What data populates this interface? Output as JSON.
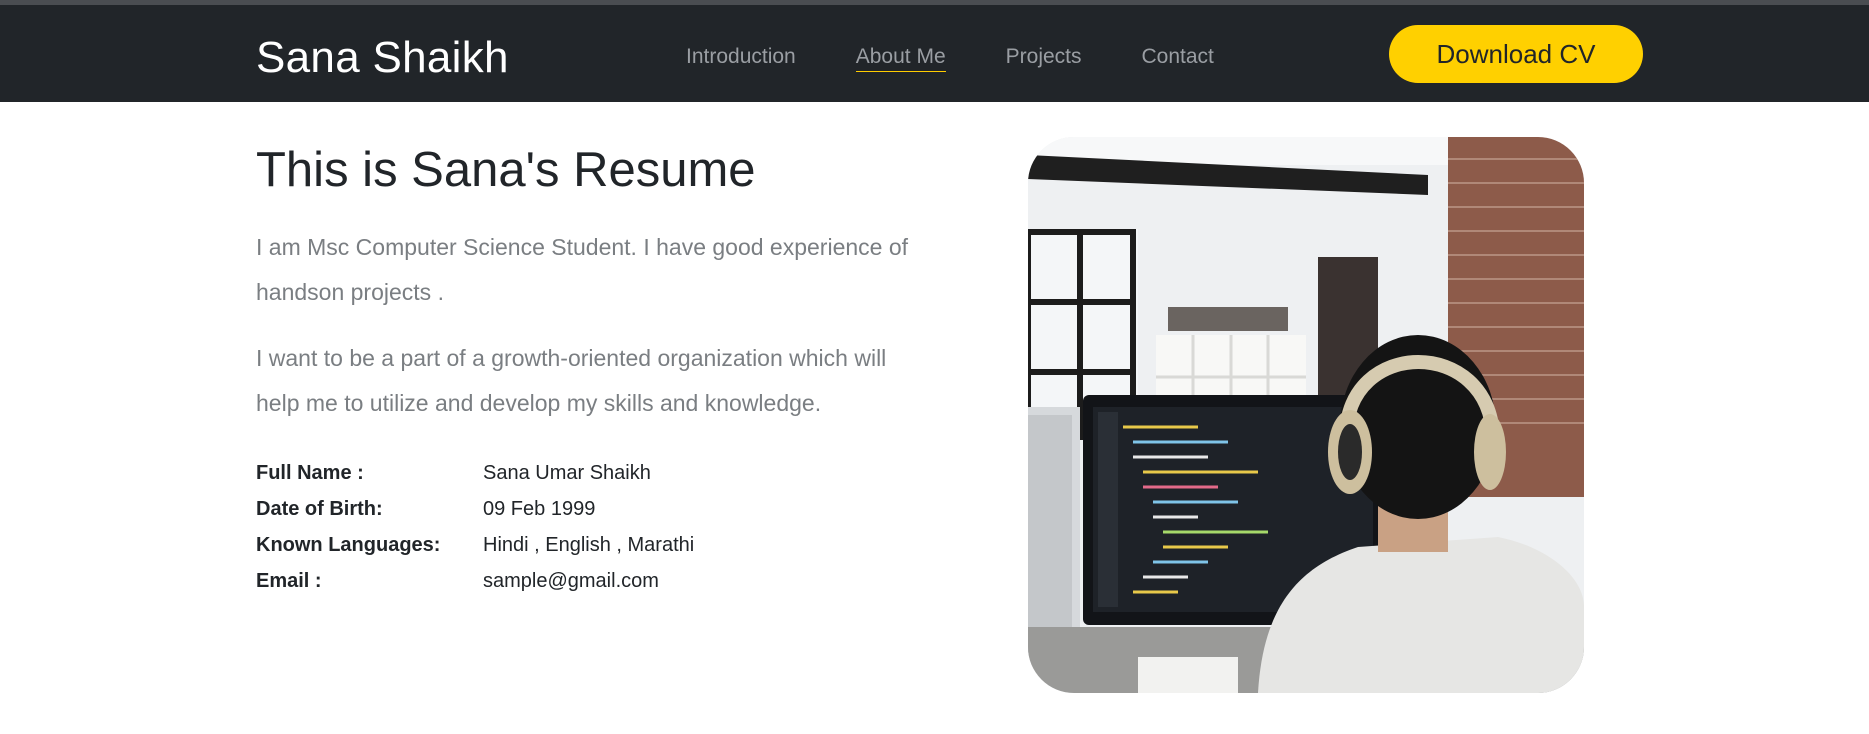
{
  "header": {
    "brand": "Sana Shaikh",
    "nav": [
      "Introduction",
      "About Me",
      "Projects",
      "Contact"
    ],
    "active_nav": "About Me",
    "cv_button": "Download CV"
  },
  "about": {
    "title": "This is Sana's Resume",
    "paragraphs": [
      "I am Msc Computer Science Student. I have good experience of handson projects .",
      "I want to be a part of a growth-oriented organization which will help me to utilize and develop my skills and knowledge."
    ],
    "details": [
      {
        "label": "Full Name :",
        "value": "Sana Umar Shaikh"
      },
      {
        "label": "Date of Birth:",
        "value": "09 Feb 1999"
      },
      {
        "label": "Known Languages:",
        "value": "Hindi , English , Marathi"
      },
      {
        "label": "Email :",
        "value": "sample@gmail.com"
      }
    ]
  },
  "colors": {
    "navbar": "#212529",
    "accent": "#ffd000",
    "muted_text": "#7a7e82"
  }
}
